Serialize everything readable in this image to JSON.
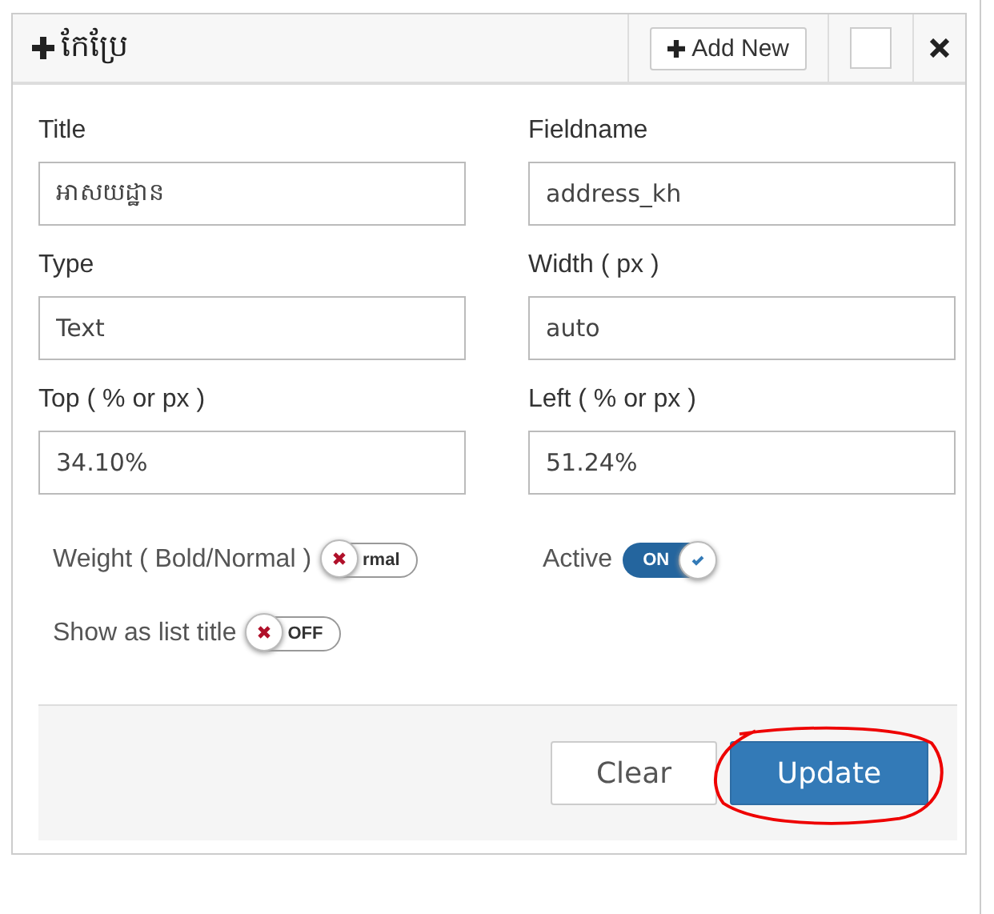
{
  "header": {
    "title": "កែប្រែ",
    "add_button": "Add New",
    "checked": false
  },
  "fields": [
    {
      "label": "Title",
      "value": "អាសយដ្ឋាន"
    },
    {
      "label": "Fieldname",
      "value": "address_kh"
    },
    {
      "label": "Type",
      "value": "Text"
    },
    {
      "label": "Width ( px )",
      "value": "auto"
    },
    {
      "label": "Top ( % or px )",
      "value": "34.10%"
    },
    {
      "label": "Left ( % or px )",
      "value": "51.24%"
    }
  ],
  "switches": [
    {
      "label": "Weight ( Bold/Normal )",
      "on": false,
      "text": "rmal"
    },
    {
      "label": "Active",
      "on": true,
      "text": "ON"
    },
    {
      "label": "Show as list title",
      "on": false,
      "text": "OFF"
    }
  ],
  "buttons": [
    {
      "label": "Clear",
      "kind": "default",
      "circled": false
    },
    {
      "label": "Update",
      "kind": "primary",
      "circled": true
    }
  ]
}
